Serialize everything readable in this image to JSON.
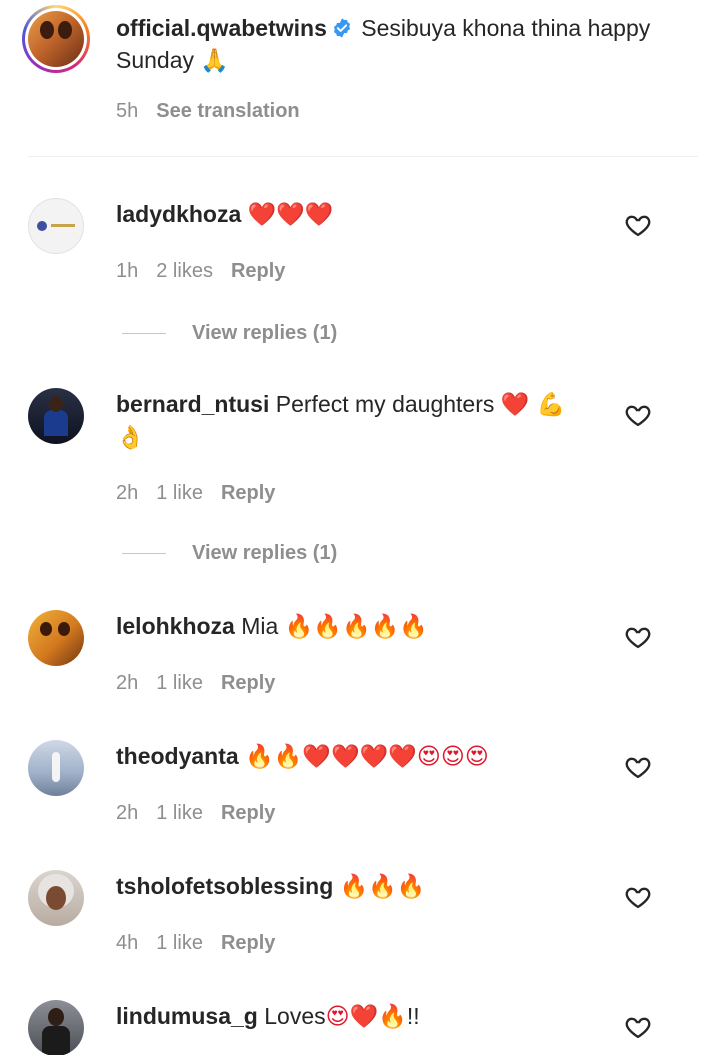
{
  "post": {
    "username": "official.qwabetwins",
    "caption_line1": "Sesibuya khona thina happy",
    "caption_line2": "Sunday",
    "caption_emoji": "🙏",
    "time": "5h",
    "see_translation": "See translation"
  },
  "comments": [
    {
      "username": "ladydkhoza",
      "text": "",
      "emoji": "❤️❤️❤️",
      "time": "1h",
      "likes": "2 likes",
      "reply": "Reply",
      "view_replies": "View replies (1)"
    },
    {
      "username": "bernard_ntusi",
      "text": "Perfect my daughters",
      "emoji": "❤️ 💪",
      "emoji2": "👌",
      "time": "2h",
      "likes": "1 like",
      "reply": "Reply",
      "view_replies": "View replies (1)"
    },
    {
      "username": "lelohkhoza",
      "text": "Mia",
      "emoji": "🔥🔥🔥🔥🔥",
      "time": "2h",
      "likes": "1 like",
      "reply": "Reply"
    },
    {
      "username": "theodyanta",
      "text": "",
      "emoji": "🔥🔥❤️❤️❤️❤️😍😍😍",
      "time": "2h",
      "likes": "1 like",
      "reply": "Reply"
    },
    {
      "username": "tsholofetsoblessing",
      "text": "",
      "emoji": "🔥🔥🔥",
      "time": "4h",
      "likes": "1 like",
      "reply": "Reply"
    },
    {
      "username": "lindumusa_g",
      "text": "Loves",
      "emoji": "😍❤️🔥",
      "suffix": "!!"
    }
  ],
  "colors": {
    "text": "#262626",
    "meta": "#8e8e8e",
    "verified": "#3897f0",
    "divider": "#efefef"
  }
}
